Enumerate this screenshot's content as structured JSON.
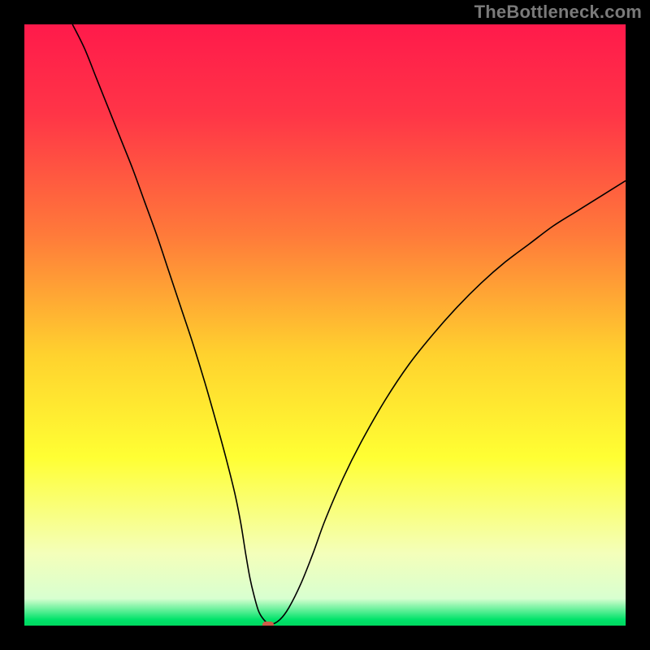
{
  "watermark": "TheBottleneck.com",
  "chart_data": {
    "type": "line",
    "title": "",
    "xlabel": "",
    "ylabel": "",
    "xlim": [
      0,
      100
    ],
    "ylim": [
      0,
      100
    ],
    "background_gradient": {
      "stops": [
        {
          "offset": 0.0,
          "color": "#ff1a4b"
        },
        {
          "offset": 0.15,
          "color": "#ff3547"
        },
        {
          "offset": 0.35,
          "color": "#ff7a3a"
        },
        {
          "offset": 0.55,
          "color": "#ffd22e"
        },
        {
          "offset": 0.72,
          "color": "#ffff33"
        },
        {
          "offset": 0.88,
          "color": "#f4ffba"
        },
        {
          "offset": 0.955,
          "color": "#d8ffd0"
        },
        {
          "offset": 0.99,
          "color": "#00e36a"
        },
        {
          "offset": 1.0,
          "color": "#00d860"
        }
      ]
    },
    "series": [
      {
        "name": "curve",
        "type": "line",
        "color": "#000000",
        "width": 1.6,
        "x": [
          8,
          10,
          12,
          14,
          16,
          18,
          20,
          22,
          24,
          26,
          28,
          30,
          32,
          33.5,
          35,
          36,
          36.8,
          37.5,
          38.2,
          39,
          40,
          41,
          42.5,
          44,
          46,
          48,
          50,
          53,
          56,
          60,
          64,
          68,
          72,
          76,
          80,
          84,
          88,
          92,
          96,
          100
        ],
        "y": [
          100,
          96,
          91,
          86,
          81,
          76,
          70.5,
          65,
          59,
          53,
          47,
          40.5,
          33.5,
          28,
          22,
          17,
          12,
          8,
          5,
          2.3,
          0.8,
          0.2,
          1.0,
          3.0,
          7.0,
          12,
          17.5,
          24.5,
          30.5,
          37.5,
          43.5,
          48.5,
          53,
          57,
          60.5,
          63.5,
          66.5,
          69,
          71.5,
          74
        ]
      }
    ],
    "marker": {
      "x": 40.5,
      "y": 0.0,
      "color": "#cf5d49"
    }
  }
}
